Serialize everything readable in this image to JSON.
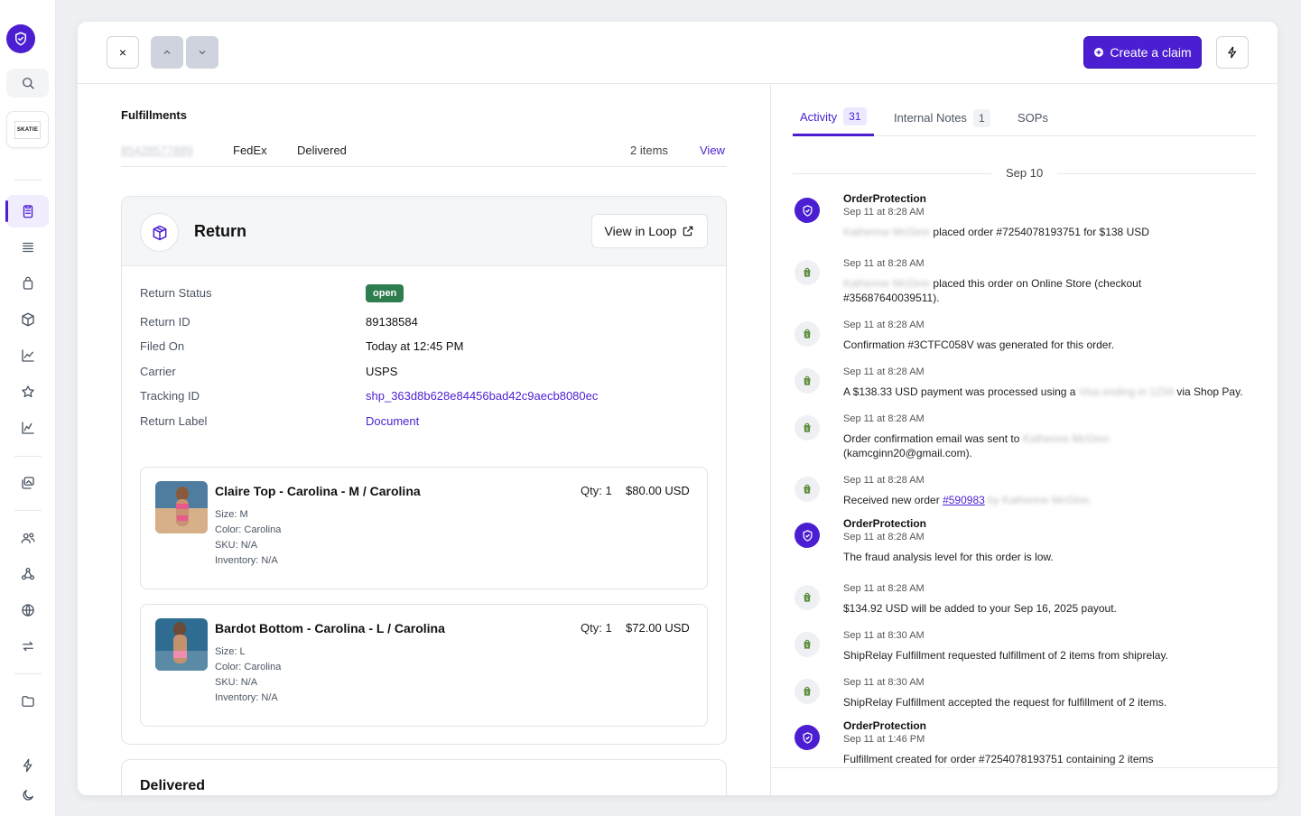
{
  "topbar": {
    "close_label": "×",
    "up_label": "⌃",
    "down_label": "⌄",
    "claim_label": "Create a claim"
  },
  "store": {
    "name": "SKATIE"
  },
  "fulfillments": {
    "title": "Fulfillments",
    "tracking": "85428577889",
    "carrier": "FedEx",
    "status": "Delivered",
    "items": "2 items",
    "view_label": "View"
  },
  "return": {
    "title": "Return",
    "view_loop_label": "View in Loop",
    "fields": [
      {
        "label": "Return Status",
        "value": "open"
      },
      {
        "label": "Return ID",
        "value": "89138584"
      },
      {
        "label": "Filed On",
        "value": "Today at 12:45 PM"
      },
      {
        "label": "Carrier",
        "value": "USPS"
      },
      {
        "label": "Tracking ID",
        "value": "shp_363d8b628e84456bad42c9aecb8080ec"
      },
      {
        "label": "Return Label",
        "value": "Document"
      }
    ],
    "items": [
      {
        "name": "Claire Top - Carolina - M / Carolina",
        "qty": "Qty: 1",
        "price": "$80.00 USD",
        "size": "Size: M",
        "color": "Color: Carolina",
        "sku": "SKU: N/A",
        "inventory": "Inventory: N/A"
      },
      {
        "name": "Bardot Bottom - Carolina - L / Carolina",
        "qty": "Qty: 1",
        "price": "$72.00 USD",
        "size": "Size: L",
        "color": "Color: Carolina",
        "sku": "SKU: N/A",
        "inventory": "Inventory: N/A"
      }
    ]
  },
  "delivered": {
    "title": "Delivered"
  },
  "tabs": [
    {
      "label": "Activity",
      "count": "31"
    },
    {
      "label": "Internal Notes",
      "count": "1"
    },
    {
      "label": "SOPs",
      "count": ""
    }
  ],
  "activity": {
    "date": "Sep 10",
    "events": [
      {
        "source": "OrderProtection",
        "time": "Sep 11 at 8:28 AM",
        "msg": "placed order #7254078193751 for $138 USD",
        "redacted": "Katherine McGinn"
      },
      {
        "source": "",
        "time": "Sep 11 at 8:28 AM",
        "msg": "placed this order on Online Store (checkout",
        "msg2": "#35687640039511).",
        "redacted": "Katherine McGinn"
      },
      {
        "source": "",
        "time": "Sep 11 at 8:28 AM",
        "msg": "Confirmation #3CTFC058V was generated for this order."
      },
      {
        "source": "",
        "time": "Sep 11 at 8:28 AM",
        "msg": "A $138.33 USD payment was processed using a",
        "redacted": "Visa ending in 1234",
        "msg_tail": "via Shop Pay."
      },
      {
        "source": "",
        "time": "Sep 11 at 8:28 AM",
        "msg": "Order confirmation email was sent to",
        "redacted": "Katherine McGinn",
        "msg2": "(kamcginn20@gmail.com)."
      },
      {
        "source": "",
        "time": "Sep 11 at 8:28 AM",
        "msg": "Received new order",
        "link": "#590983",
        "redacted": "by Katherine McGinn."
      },
      {
        "source": "OrderProtection",
        "time": "Sep 11 at 8:28 AM",
        "msg": "The fraud analysis level for this order is low."
      },
      {
        "source": "",
        "time": "Sep 11 at 8:28 AM",
        "msg": "$134.92 USD will be added to your Sep 16, 2025 payout."
      },
      {
        "source": "",
        "time": "Sep 11 at 8:30 AM",
        "msg": "ShipRelay Fulfillment requested fulfillment of 2 items from shiprelay."
      },
      {
        "source": "",
        "time": "Sep 11 at 8:30 AM",
        "msg": "ShipRelay Fulfillment accepted the request for fulfillment of 2 items."
      },
      {
        "source": "OrderProtection",
        "time": "Sep 11 at 1:46 PM",
        "msg": "Fulfillment created for order #7254078193751 containing 2 items"
      }
    ]
  },
  "colors": {
    "accent": "#4b1fd1",
    "open_badge": "#2e7d4f"
  },
  "icons": [
    "shield-check-icon",
    "search-icon",
    "clipboard-icon",
    "list-icon",
    "bag-icon",
    "box-icon",
    "chart-icon",
    "star-icon",
    "trend-icon",
    "images-icon",
    "users-icon",
    "webhook-icon",
    "globe-icon",
    "swap-icon",
    "folder-icon",
    "bolt-icon",
    "moon-icon",
    "shopify-icon",
    "external-link-icon",
    "plus-circle-icon"
  ]
}
